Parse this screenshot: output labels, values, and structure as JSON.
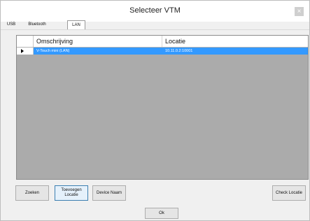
{
  "window": {
    "title": "Selecteer VTM",
    "close_glyph": "×"
  },
  "tabs": [
    {
      "label": "USB",
      "active": false
    },
    {
      "label": "Bluetooth",
      "active": false
    },
    {
      "label": "LAN",
      "active": true
    }
  ],
  "grid": {
    "columns": [
      "Omschrijving",
      "Locatie"
    ],
    "rows": [
      {
        "selected": true,
        "cells": [
          "V-Touch mini (LAN)",
          "10.11.0.2:10001"
        ]
      }
    ]
  },
  "buttons": {
    "zoeken": "Zoeken",
    "toevoegen_locatie": "Toevoegen Locatie",
    "device_naam": "Device Naam",
    "check_locatie": "Check Locatie",
    "ok": "Ok"
  },
  "colors": {
    "selection": "#3399ff",
    "grid_bg": "#ababab"
  }
}
